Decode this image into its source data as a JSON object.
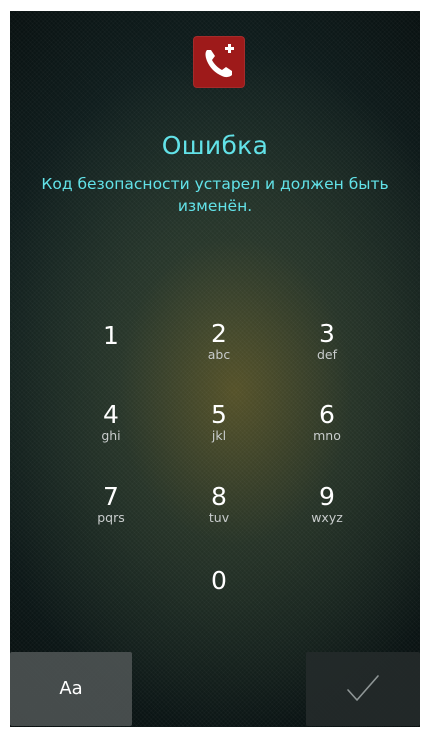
{
  "app": {
    "icon": "phone-plus-icon",
    "brand_color": "#9e1a1a"
  },
  "error": {
    "title": "Ошибка",
    "message": "Код безопасности устарел и должен быть изменён.",
    "accent_color": "#62e2e8"
  },
  "keypad": {
    "keys": [
      {
        "digit": "1",
        "letters": ""
      },
      {
        "digit": "2",
        "letters": "abc"
      },
      {
        "digit": "3",
        "letters": "def"
      },
      {
        "digit": "4",
        "letters": "ghi"
      },
      {
        "digit": "5",
        "letters": "jkl"
      },
      {
        "digit": "6",
        "letters": "mno"
      },
      {
        "digit": "7",
        "letters": "pqrs"
      },
      {
        "digit": "8",
        "letters": "tuv"
      },
      {
        "digit": "9",
        "letters": "wxyz"
      },
      {
        "digit": "0",
        "letters": ""
      }
    ]
  },
  "buttons": {
    "keyboard_toggle_label": "Aa",
    "confirm_icon": "checkmark-icon"
  }
}
